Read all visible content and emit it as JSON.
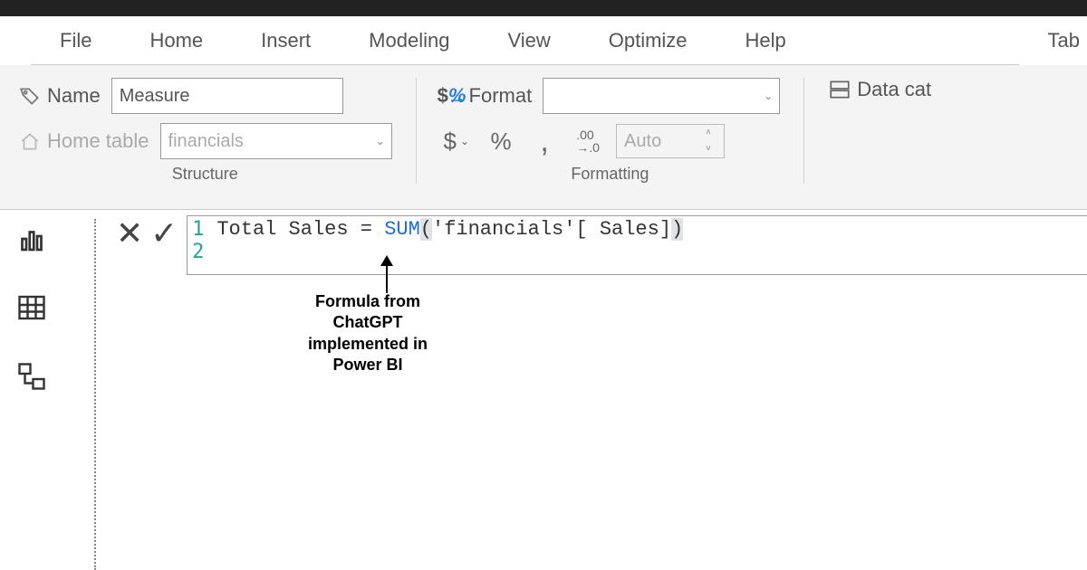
{
  "ribbon_tabs": {
    "file": "File",
    "home": "Home",
    "insert": "Insert",
    "modeling": "Modeling",
    "view": "View",
    "optimize": "Optimize",
    "help": "Help",
    "table_tools": "Tab"
  },
  "structure": {
    "name_label": "Name",
    "name_value": "Measure",
    "home_table_label": "Home table",
    "home_table_value": "financials",
    "group_label": "Structure"
  },
  "formatting": {
    "format_label": "Format",
    "format_value": "",
    "currency_btn": "$",
    "percent_btn": "%",
    "comma_btn": ",",
    "decimals_btn": ".00",
    "auto_value": "Auto",
    "group_label": "Formatting"
  },
  "right": {
    "data_cat_label": "Data cat"
  },
  "formula": {
    "line1_gutter": "1",
    "line2_gutter": "2",
    "code_text_prefix": "Total Sales = ",
    "code_fn": "SUM",
    "code_arg": "'financials'[ Sales]",
    "full": "Total Sales = SUM('financials'[ Sales])"
  },
  "annotation": {
    "line1": "Formula from",
    "line2": "ChatGPT",
    "line3": "implemented in",
    "line4": "Power BI"
  }
}
